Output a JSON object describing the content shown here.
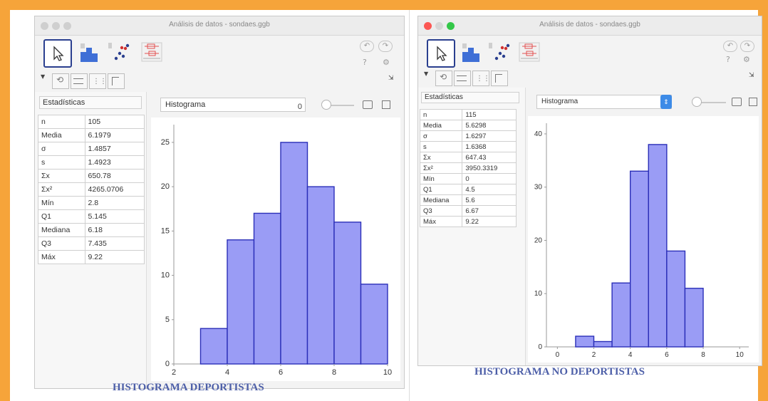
{
  "left_window": {
    "title": "Análisis de datos - sondaes.ggb",
    "help": "?",
    "stats_label": "Estadísticas",
    "dropdown": "Histograma",
    "dropdown_value": "0",
    "stats": [
      {
        "label": "n",
        "value": "105"
      },
      {
        "label": "Media",
        "value": "6.1979"
      },
      {
        "label": "σ",
        "value": "1.4857"
      },
      {
        "label": "s",
        "value": "1.4923"
      },
      {
        "label": "Σx",
        "value": "650.78"
      },
      {
        "label": "Σx²",
        "value": "4265.0706"
      },
      {
        "label": "Mín",
        "value": "2.8"
      },
      {
        "label": "Q1",
        "value": "5.145"
      },
      {
        "label": "Mediana",
        "value": "6.18"
      },
      {
        "label": "Q3",
        "value": "7.435"
      },
      {
        "label": "Máx",
        "value": "9.22"
      }
    ],
    "chart_data": {
      "type": "bar",
      "bins": [
        [
          3,
          4
        ],
        [
          4,
          5
        ],
        [
          5,
          6
        ],
        [
          6,
          7
        ],
        [
          7,
          8
        ],
        [
          8,
          9
        ],
        [
          9,
          10
        ]
      ],
      "values": [
        4,
        14,
        17,
        25,
        20,
        16,
        9
      ],
      "xlim": [
        2,
        10
      ],
      "ylim": [
        0,
        27
      ],
      "x_ticks": [
        "2",
        "4",
        "6",
        "8",
        "10"
      ],
      "y_ticks": [
        "0",
        "5",
        "10",
        "15",
        "20",
        "25"
      ],
      "bar_color": "#9a9cf5",
      "bar_edge": "#2b2fb8"
    },
    "caption": "HISTOGRAMA DEPORTISTAS"
  },
  "right_window": {
    "title": "Análisis de datos - sondaes.ggb",
    "help": "?",
    "stats_label": "Estadísticas",
    "dropdown": "Histograma",
    "stats": [
      {
        "label": "n",
        "value": "115"
      },
      {
        "label": "Media",
        "value": "5.6298"
      },
      {
        "label": "σ",
        "value": "1.6297"
      },
      {
        "label": "s",
        "value": "1.6368"
      },
      {
        "label": "Σx",
        "value": "647.43"
      },
      {
        "label": "Σx²",
        "value": "3950.3319"
      },
      {
        "label": "Mín",
        "value": "0"
      },
      {
        "label": "Q1",
        "value": "4.5"
      },
      {
        "label": "Mediana",
        "value": "5.6"
      },
      {
        "label": "Q3",
        "value": "6.67"
      },
      {
        "label": "Máx",
        "value": "9.22"
      }
    ],
    "chart_data": {
      "type": "bar",
      "bins": [
        [
          0,
          1
        ],
        [
          1,
          2
        ],
        [
          2,
          3
        ],
        [
          3,
          4
        ],
        [
          4,
          5
        ],
        [
          5,
          6
        ],
        [
          6,
          7
        ],
        [
          7,
          8
        ],
        [
          8,
          9
        ]
      ],
      "values": [
        0,
        2,
        1,
        12,
        33,
        38,
        18,
        11,
        0
      ],
      "xlim": [
        -0.6,
        10.5
      ],
      "ylim": [
        0,
        42
      ],
      "x_ticks": [
        "0",
        "2",
        "4",
        "6",
        "8",
        "10"
      ],
      "y_ticks": [
        "0",
        "10",
        "20",
        "30",
        "40"
      ],
      "bar_color": "#9a9cf5",
      "bar_edge": "#2b2fb8"
    },
    "caption": "HISTOGRAMA NO DEPORTISTAS"
  }
}
